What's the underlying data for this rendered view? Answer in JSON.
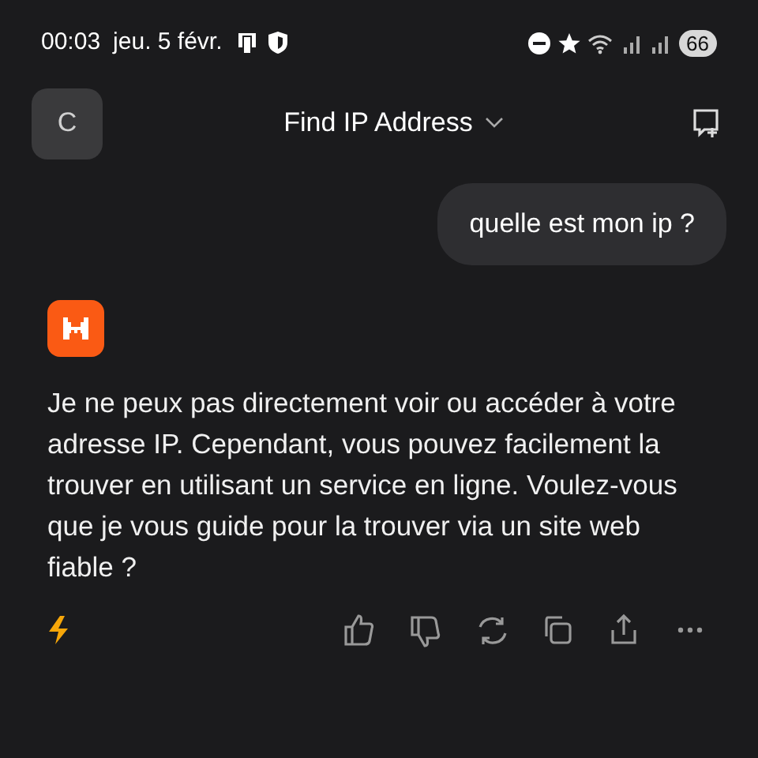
{
  "status_bar": {
    "time": "00:03",
    "date": "jeu. 5 févr.",
    "battery": "66"
  },
  "header": {
    "avatar_letter": "C",
    "title": "Find IP Address"
  },
  "messages": [
    {
      "kind": "user",
      "text": "quelle est mon ip ?"
    },
    {
      "kind": "assistant",
      "text": "Je ne peux pas directement voir ou accéder à votre adresse IP. Cependant, vous pouvez facilement la trouver en utilisant un service en ligne. Voulez-vous que je vous guide pour la trouver via un site web fiable ?"
    }
  ]
}
